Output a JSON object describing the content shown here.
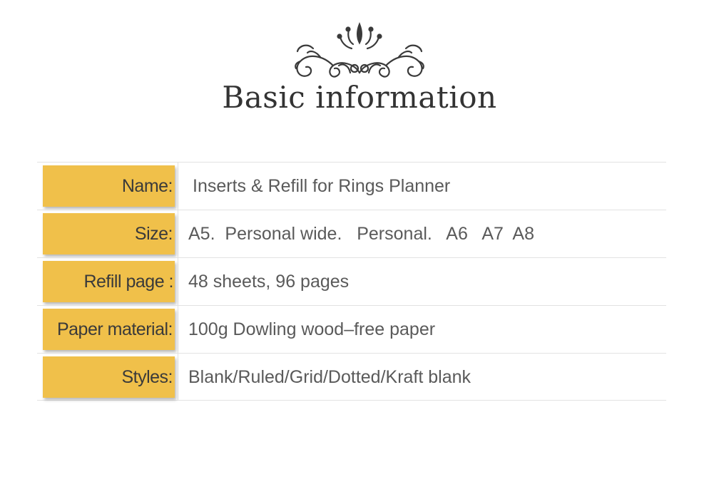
{
  "header": {
    "ornament_icon": "flourish-ornament-icon",
    "title": "Basic information"
  },
  "colors": {
    "label_background": "#f0c04a",
    "text": "#3a3a3a",
    "value_text": "#5a5a5a",
    "divider": "#e2e2e2"
  },
  "rows": [
    {
      "label": "Name:",
      "value": "Inserts & Refill for Rings Planner"
    },
    {
      "label": "Size:",
      "value": "A5.  Personal wide.   Personal.   A6   A7  A8"
    },
    {
      "label": "Refill page :",
      "value": "48 sheets, 96 pages"
    },
    {
      "label": "Paper material:",
      "value": "100g Dowling wood–free paper"
    },
    {
      "label": "Styles:",
      "value": "Blank/Ruled/Grid/Dotted/Kraft blank"
    }
  ]
}
